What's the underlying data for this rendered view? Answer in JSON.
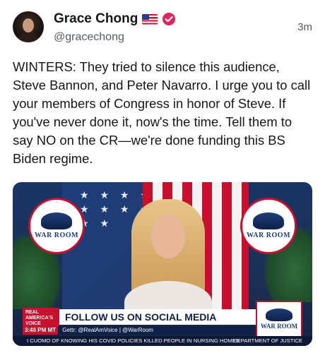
{
  "author": {
    "name": "Grace Chong",
    "handle": "@gracechong",
    "flag_icon": "us-flag-icon",
    "verified_icon": "verified-badge-icon",
    "verified_color": "#e0245e"
  },
  "timestamp": "3m",
  "tweet": {
    "text": "WINTERS: They tried to silence this audience, Steve Bannon, and Peter Navarro. I urge you to call your members of Congress in honor of Steve. If you've never done it, now's the time. Tell them to say NO on the CR—we're done funding this BS Biden regime."
  },
  "media": {
    "logo_text_left": "WAR ROOM",
    "logo_text_right": "WAR ROOM",
    "chyron": {
      "tag": "REAL AMERICA'S VOICE",
      "headline": "FOLLOW US ON SOCIAL MEDIA",
      "time": "3:46 PM MT",
      "subline": "Gettr: @RealAmVoice | @WarRoom",
      "ticker_left": "I CUOMO OF KNOWING HIS COVID POLICIES KILLED PEOPLE IN NURSING HOMES",
      "ticker_right": "DEPARTMENT OF JUSTICE",
      "logo_text": "WAR ROOM"
    }
  }
}
